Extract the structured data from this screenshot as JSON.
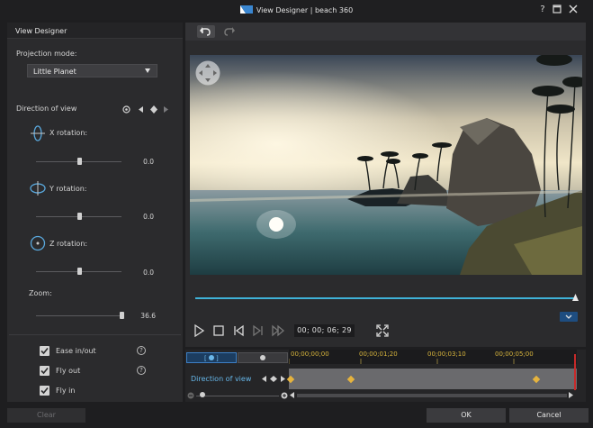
{
  "window": {
    "title": "View Designer  |  beach 360",
    "help_label": "?"
  },
  "left_panel": {
    "header": "View Designer",
    "projection_label": "Projection mode:",
    "projection_value": "Little Planet",
    "direction_label": "Direction of view",
    "x_label": "X rotation:",
    "x_value": "0.0",
    "y_label": "Y rotation:",
    "y_value": "0.0",
    "z_label": "Z rotation:",
    "z_value": "0.0",
    "zoom_label": "Zoom:",
    "zoom_value": "36.6",
    "options": [
      {
        "label": "Ease in/out",
        "checked": true,
        "help": true
      },
      {
        "label": "Fly out",
        "checked": true,
        "help": true
      },
      {
        "label": "Fly in",
        "checked": true,
        "help": false
      }
    ],
    "help_glyph": "?"
  },
  "player": {
    "timecode": "00; 00; 06; 29",
    "progress": 1.0
  },
  "timeline": {
    "track_name": "Direction of view",
    "ruler_labels": [
      "00;00;00;00",
      "00;00;01;20",
      "00;00;03;10",
      "00;00;05;00"
    ],
    "keyframes_at": [
      0.0,
      0.22,
      0.86
    ]
  },
  "buttons": {
    "clear": "Clear",
    "ok": "OK",
    "cancel": "Cancel"
  },
  "colors": {
    "accent": "#3fb2d8",
    "keyframe": "#e5b33e",
    "playhead": "#c62a2a",
    "track_label": "#66b6e8"
  }
}
